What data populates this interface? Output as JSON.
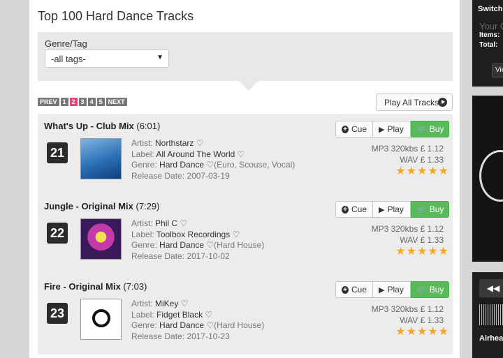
{
  "page": {
    "title": "Top 100 Hard Dance Tracks"
  },
  "filter": {
    "label": "Genre/Tag",
    "selected": "-all tags-"
  },
  "pager": {
    "prev": "PREV",
    "pages": [
      "1",
      "2",
      "3",
      "4",
      "5"
    ],
    "active": "2",
    "next": "NEXT"
  },
  "play_all": {
    "label": "Play All Tracks"
  },
  "buttons": {
    "cue": "Cue",
    "play": "Play",
    "buy": "Buy"
  },
  "labels": {
    "artist": "Artist:",
    "label": "Label:",
    "genre": "Genre:",
    "release": "Release Date:"
  },
  "tracks": [
    {
      "rank": "21",
      "title": "What's Up - Club Mix",
      "duration": "(6:01)",
      "artist": "Northstarz",
      "label": "All Around The World",
      "genre": "Hard Dance",
      "subgenres": "(Euro, Scouse, Vocal)",
      "release_date": "2007-03-19",
      "mp3": "MP3 320kbs",
      "mp3_price": "£ 1.12",
      "wav": "WAV",
      "wav_price": "£ 1.33",
      "rating": 5
    },
    {
      "rank": "22",
      "title": "Jungle - Original Mix",
      "duration": "(7:29)",
      "artist": "Phil C",
      "label": "Toolbox Recordings",
      "genre": "Hard Dance",
      "subgenres": "(Hard House)",
      "release_date": "2017-10-02",
      "mp3": "MP3 320kbs",
      "mp3_price": "£ 1.12",
      "wav": "WAV",
      "wav_price": "£ 1.33",
      "rating": 5
    },
    {
      "rank": "23",
      "title": "Fire - Original Mix",
      "duration": "(7:03)",
      "artist": "MiKey",
      "label": "Fidget Black",
      "genre": "Hard Dance",
      "subgenres": "(Hard House)",
      "release_date": "2017-10-23",
      "mp3": "MP3 320kbs",
      "mp3_price": "£ 1.12",
      "wav": "WAV",
      "wav_price": "£ 1.33",
      "rating": 5
    }
  ],
  "sidebar": {
    "switch": "Switch",
    "your": "Your C",
    "items": "Items:",
    "total": "Total:",
    "view": "View B",
    "track": "Airhead"
  },
  "colors": {
    "buy": "#5cb85c",
    "active_page": "#e8427c",
    "star": "#f5a623"
  },
  "icons": [
    "plus-circle-icon",
    "play-icon",
    "cart-icon",
    "heart-icon",
    "star-icon",
    "play-circle-icon",
    "rewind-icon"
  ]
}
